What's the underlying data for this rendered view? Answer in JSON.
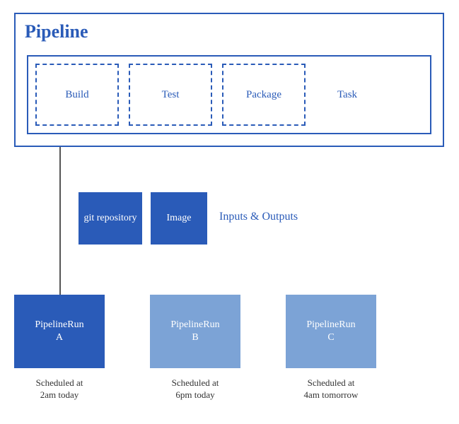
{
  "pipeline": {
    "title": "Pipeline",
    "tasks": [
      "Build",
      "Test",
      "Package"
    ],
    "task_type_label": "Task"
  },
  "io": {
    "git": "git\nrepository",
    "image": "Image",
    "label": "Inputs & Outputs"
  },
  "runs": [
    {
      "name": "PipelineRun\nA",
      "schedule": "Scheduled at\n2am today",
      "active": true
    },
    {
      "name": "PipelineRun\nB",
      "schedule": "Scheduled at\n6pm today",
      "active": false
    },
    {
      "name": "PipelineRun\nC",
      "schedule": "Scheduled at\n4am tomorrow",
      "active": false
    }
  ]
}
